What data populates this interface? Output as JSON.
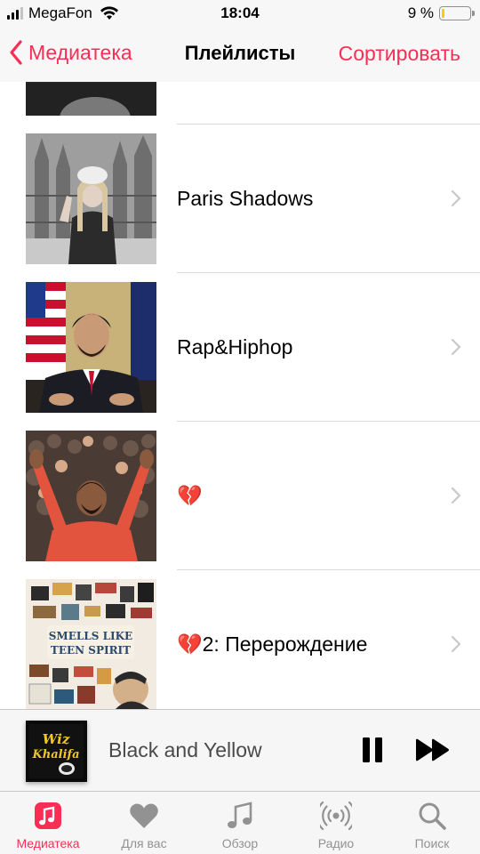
{
  "status": {
    "carrier": "MegaFon",
    "time": "18:04",
    "battery_text": "9 %",
    "battery_level": 0.09
  },
  "nav": {
    "back_label": "Медиатека",
    "title": "Плейлисты",
    "sort_label": "Сортировать"
  },
  "playlists": [
    {
      "title": "",
      "art_icon": "partial-cover-dark"
    },
    {
      "title": "Paris Shadows",
      "art_icon": "cover-cathedral-portrait"
    },
    {
      "title": "Rap&Hiphop",
      "art_icon": "cover-flag-office-portrait"
    },
    {
      "title": "💔",
      "art_icon": "cover-crowd-orange-sweater"
    },
    {
      "title": "💔2: Перерождение",
      "art_icon": "cover-smells-like-teen-spirit"
    }
  ],
  "art_text": {
    "cover_4_line1": "SMELLS LIKE",
    "cover_4_line2": "TEEN SPIRIT",
    "mini_line1": "Wiz",
    "mini_line2": "Khalifa"
  },
  "mini_player": {
    "title": "Black and Yellow",
    "pause_icon": "pause-icon",
    "next_icon": "fast-forward-icon"
  },
  "tabs": [
    {
      "label": "Медиатека",
      "icon": "library-note-icon",
      "active": true
    },
    {
      "label": "Для вас",
      "icon": "heart-icon",
      "active": false
    },
    {
      "label": "Обзор",
      "icon": "music-note-icon",
      "active": false
    },
    {
      "label": "Радио",
      "icon": "radio-icon",
      "active": false
    },
    {
      "label": "Поиск",
      "icon": "search-icon",
      "active": false
    }
  ],
  "colors": {
    "accent": "#fa2d55",
    "inactive_tab": "#929292",
    "separator": "#d9d9dc",
    "battery_low": "#ffcc00"
  }
}
